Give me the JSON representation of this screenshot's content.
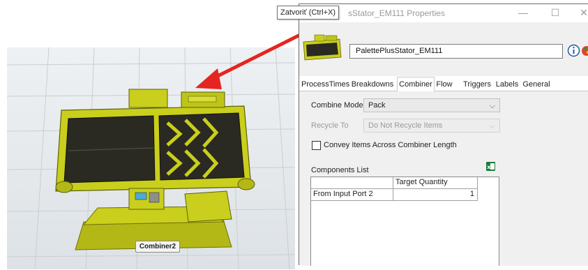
{
  "tooltip": {
    "text": "Zatvoriť (Ctrl+X)"
  },
  "window": {
    "title": "sStator_EM111  Properties",
    "controls": {
      "minimize": "—",
      "maximize": "☐",
      "close": "✕"
    }
  },
  "object": {
    "name": "PalettePlusStator_EM111"
  },
  "tabs": [
    "ProcessTimes",
    "Breakdowns",
    "Combiner",
    "Flow",
    "Triggers",
    "Labels",
    "General"
  ],
  "active_tab": "Combiner",
  "combiner": {
    "combine_mode_label": "Combine Mode",
    "combine_mode_value": "Pack",
    "recycle_to_label": "Recycle To",
    "recycle_to_value": "Do Not Recycle Items",
    "convey_label": "Convey Items Across Combiner Length",
    "convey_checked": false,
    "components_list_label": "Components List",
    "table": {
      "columns": [
        "",
        "Target Quantity"
      ],
      "rows": [
        {
          "label": "From Input Port 2",
          "quantity": "1"
        }
      ]
    }
  },
  "viewport": {
    "object_label": "Combiner2"
  },
  "colors": {
    "model_yellow": "#c9cf1c",
    "arrow_red": "#e52520",
    "belt_dark": "#2a2a22"
  }
}
